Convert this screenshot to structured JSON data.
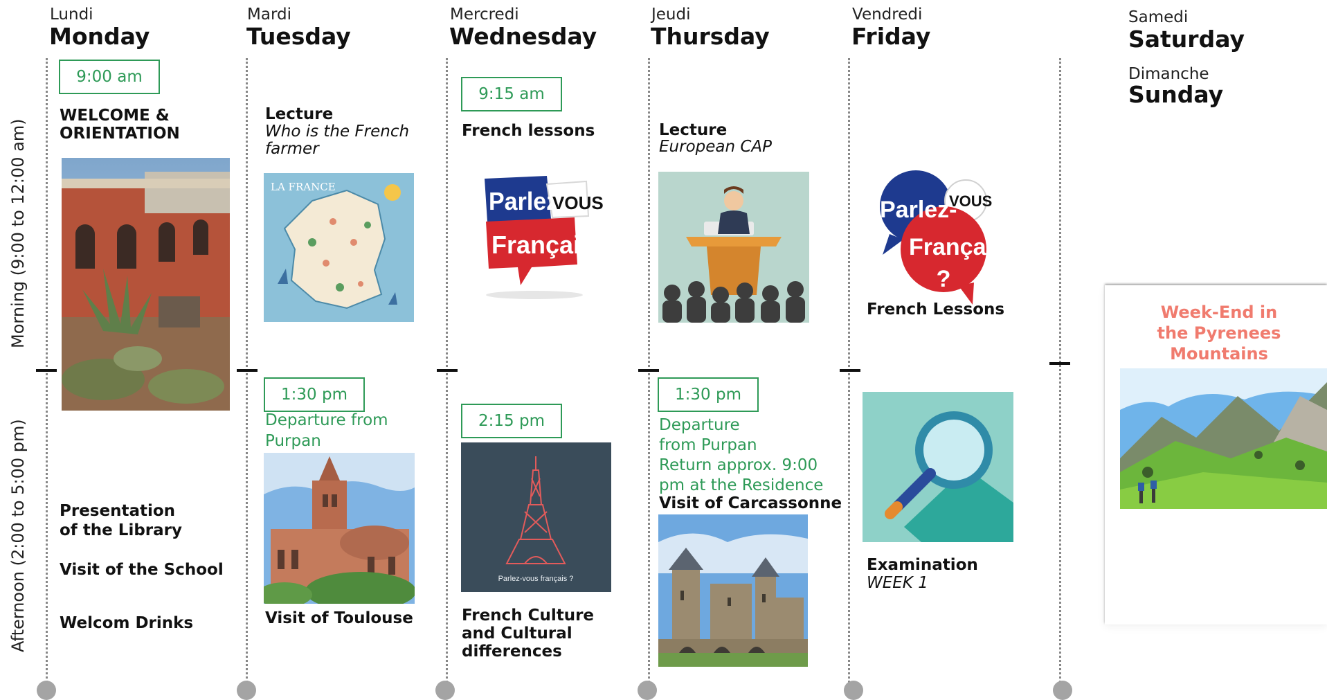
{
  "days": [
    {
      "fr": "Lundi",
      "en": "Monday"
    },
    {
      "fr": "Mardi",
      "en": "Tuesday"
    },
    {
      "fr": "Mercredi",
      "en": "Wednesday"
    },
    {
      "fr": "Jeudi",
      "en": "Thursday"
    },
    {
      "fr": "Vendredi",
      "en": "Friday"
    },
    {
      "fr": "Samedi",
      "en": "Saturday"
    },
    {
      "fr": "Dimanche",
      "en": "Sunday"
    }
  ],
  "side_labels": {
    "morning": "Morning (9:00 to 12:00 am)",
    "afternoon": "Afternoon (2:00 to 5:00 pm)"
  },
  "monday": {
    "time": "9:00 am",
    "title": "WELCOME & ORIENTATION",
    "pm_items": [
      "Presentation",
      "of the Library",
      "Visit of the School",
      "Welcom Drinks"
    ]
  },
  "tuesday": {
    "am_title": "Lecture",
    "am_sub": "Who is the French farmer",
    "map_label": "LA FRANCE",
    "pm_time": "1:30 pm",
    "pm_green": "Departure from Purpan",
    "pm_title": "Visit of Toulouse"
  },
  "wednesday": {
    "time": "9:15 am",
    "am_title": "French lessons",
    "logo_l1": "Parlez-",
    "logo_vous": "VOUS",
    "logo_l2": "Français?",
    "pm_time": "2:15  pm",
    "tower_caption": "Parlez-vous français ?",
    "pm_title": "French Culture and Cultural differences"
  },
  "thursday": {
    "am_title": "Lecture",
    "am_sub": "European CAP",
    "pm_time": "1:30 pm",
    "pm_green_1": "Departure",
    "pm_green_2": "from Purpan",
    "pm_green_3": "Return approx. 9:00",
    "pm_green_4": "pm at the Residence",
    "pm_title": "Visit of Carcassonne"
  },
  "friday": {
    "logo_l1": "Parlez-",
    "logo_vous": "VOUS",
    "logo_l2": "Français",
    "logo_q": "?",
    "am_title": "French Lessons",
    "pm_title": "Examination",
    "pm_sub": "WEEK 1"
  },
  "weekend": {
    "title_l1": "Week-End in",
    "title_l2": "the Pyrenees",
    "title_l3": "Mountains"
  },
  "colors": {
    "green": "#2e9a57",
    "coral": "#f07b6e",
    "red": "#d7282f",
    "blue": "#1e3a8f"
  }
}
